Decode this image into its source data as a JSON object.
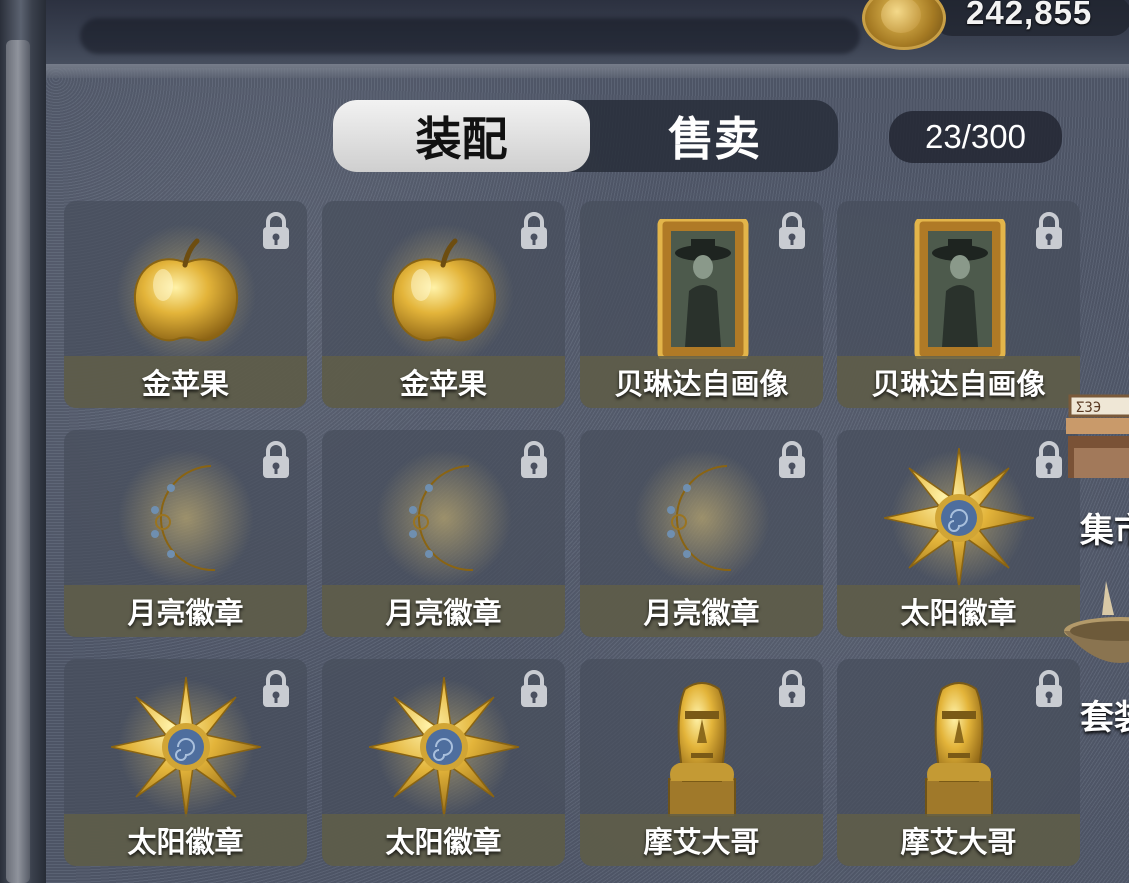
{
  "currency": {
    "amount": "242,855",
    "icon": "coin-icon"
  },
  "tabs": [
    {
      "label": "装配",
      "selected": true
    },
    {
      "label": "售卖",
      "selected": false
    }
  ],
  "inventory": {
    "count": "23/300"
  },
  "items": [
    {
      "label": "金苹果",
      "icon": "golden-apple-icon"
    },
    {
      "label": "金苹果",
      "icon": "golden-apple-icon"
    },
    {
      "label": "贝琳达自画像",
      "icon": "portrait-icon"
    },
    {
      "label": "贝琳达自画像",
      "icon": "portrait-icon"
    },
    {
      "label": "月亮徽章",
      "icon": "moon-badge-icon"
    },
    {
      "label": "月亮徽章",
      "icon": "moon-badge-icon"
    },
    {
      "label": "月亮徽章",
      "icon": "moon-badge-icon"
    },
    {
      "label": "太阳徽章",
      "icon": "sun-badge-icon"
    },
    {
      "label": "太阳徽章",
      "icon": "sun-badge-icon"
    },
    {
      "label": "太阳徽章",
      "icon": "sun-badge-icon"
    },
    {
      "label": "摩艾大哥",
      "icon": "moai-statue-icon"
    },
    {
      "label": "摩艾大哥",
      "icon": "moai-statue-icon"
    }
  ],
  "side": [
    {
      "label": "集市",
      "icon": "market-stall-icon"
    },
    {
      "label": "套装",
      "icon": "bowl-icon"
    }
  ],
  "colors": {
    "gold": "#d4a62a",
    "panel": "#464e5c",
    "label_bar": "#605e48"
  }
}
